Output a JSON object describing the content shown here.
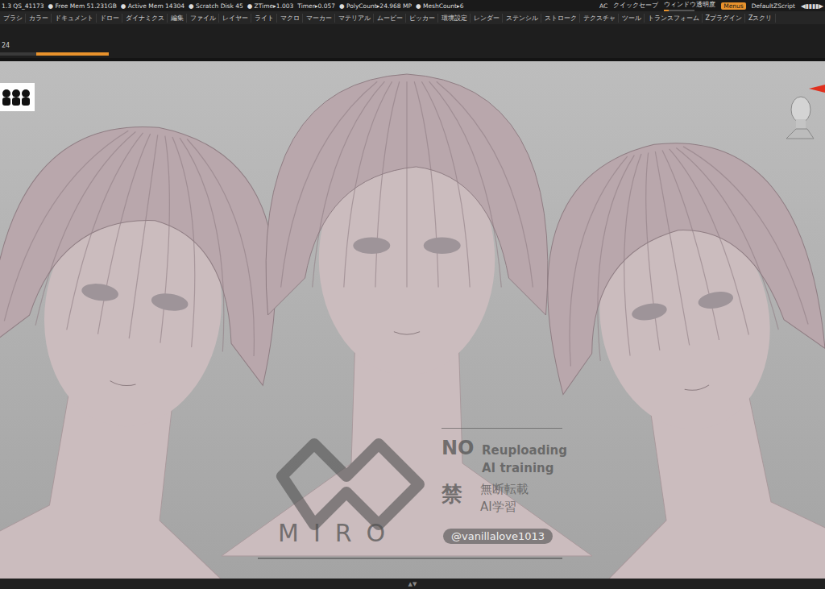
{
  "status_bar": {
    "items": [
      "1.3 QS_41173",
      "● Free Mem 51.231GB",
      "● Active Mem 14304",
      "● Scratch Disk 45",
      "● ZTime▸1.003",
      "Timer▸0.057",
      "● PolyCount▸24.968 MP",
      "● MeshCount▸6"
    ],
    "right": {
      "ac": "AC",
      "quicksave": "クイックセーブ",
      "transparency": {
        "label": "ウィンドウ透明度",
        "level": 0.15
      },
      "menus": {
        "label": "Menus",
        "selected": true
      },
      "script": "DefaultZScript",
      "scroller": "◀▮▮▮▮▶"
    }
  },
  "menu": [
    "ブラシ",
    "カラー",
    "ドキュメント",
    "ドロー",
    "ダイナミクス",
    "編集",
    "ファイル",
    "レイヤー",
    "ライト",
    "マクロ",
    "マーカー",
    "マテリアル",
    "ムービー",
    "ピッカー",
    "環境設定",
    "レンダー",
    "ステンシル",
    "ストローク",
    "テクスチャ",
    "ツール",
    "トランスフォーム",
    "Zプラグイン",
    "Zスクリ"
  ],
  "timeline": {
    "label": "24",
    "level": 0.67
  },
  "bottom_handle": "▲▼",
  "watermark": {
    "brand": "MIRO",
    "no": "NO",
    "line1": "Reuploading",
    "line2": "AI training",
    "kin": "禁",
    "line3": "無断転載",
    "line4": "AI学習",
    "handle": "@vanillalove1013"
  }
}
